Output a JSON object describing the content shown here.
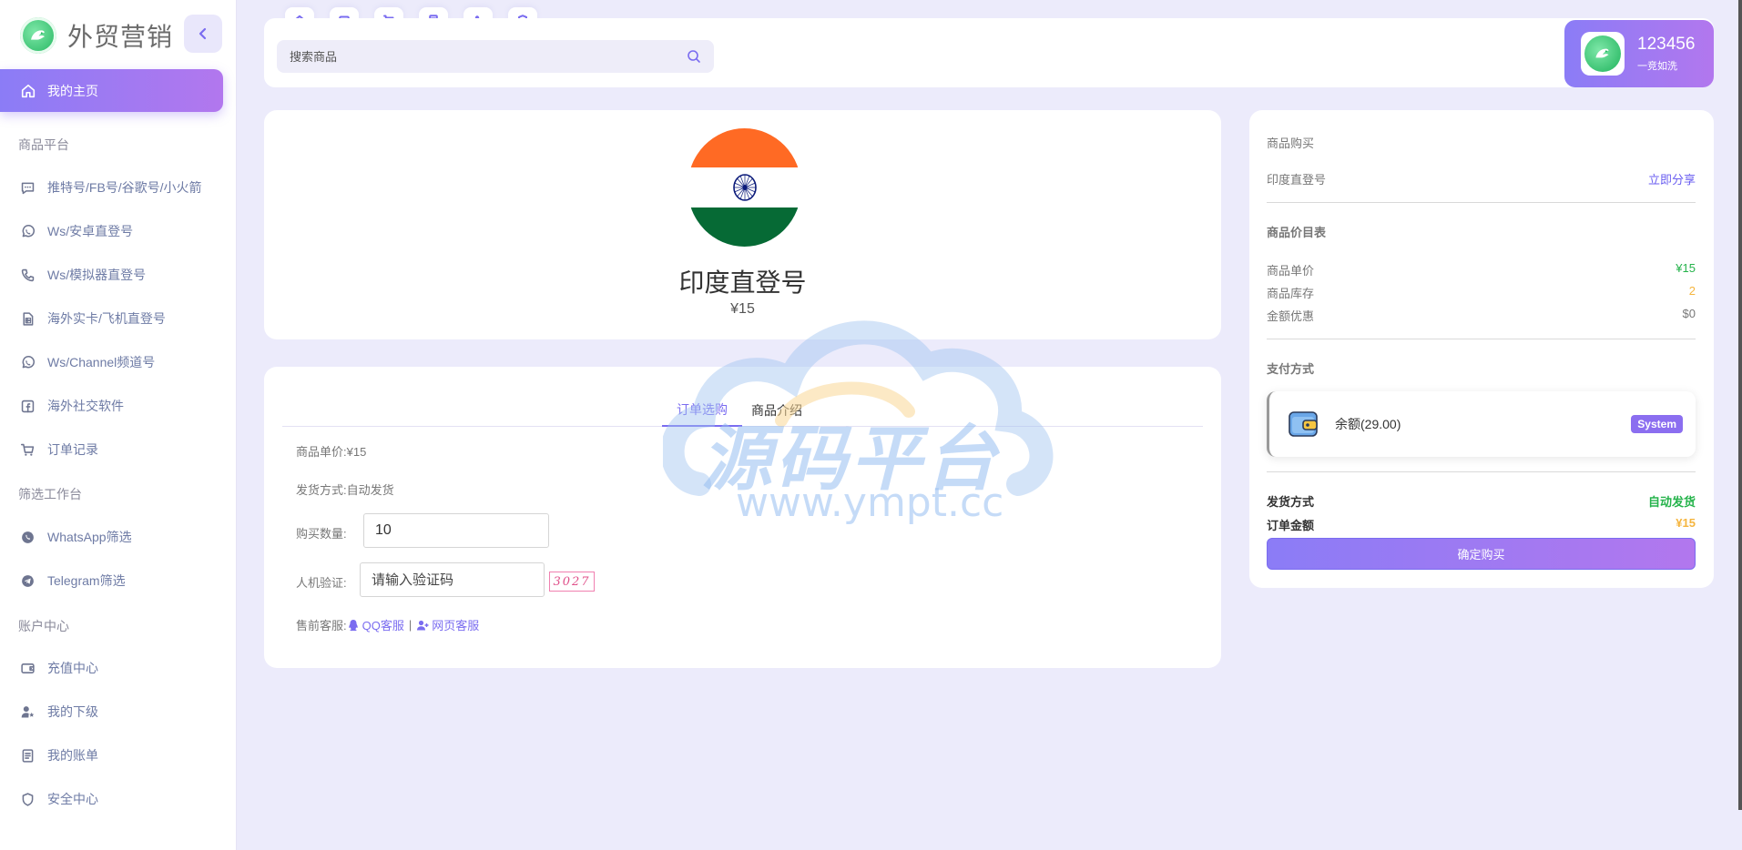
{
  "brand": {
    "name": "外贸营销"
  },
  "sidebar": {
    "active": {
      "label": "我的主页",
      "icon": "home-icon"
    },
    "sections": [
      {
        "title": "商品平台",
        "items": [
          {
            "label": "推特号/FB号/谷歌号/小火箭",
            "icon": "message-icon"
          },
          {
            "label": "Ws/安卓直登号",
            "icon": "whatsapp-icon"
          },
          {
            "label": "Ws/模拟器直登号",
            "icon": "phone-icon"
          },
          {
            "label": "海外实卡/飞机直登号",
            "icon": "sim-card-icon"
          },
          {
            "label": "Ws/Channel频道号",
            "icon": "whatsapp-icon"
          },
          {
            "label": "海外社交软件",
            "icon": "facebook-icon"
          },
          {
            "label": "订单记录",
            "icon": "cart-icon"
          }
        ]
      },
      {
        "title": "筛选工作台",
        "items": [
          {
            "label": "WhatsApp筛选",
            "icon": "whatsapp-icon"
          },
          {
            "label": "Telegram筛选",
            "icon": "telegram-icon"
          }
        ]
      },
      {
        "title": "账户中心",
        "items": [
          {
            "label": "充值中心",
            "icon": "wallet-icon"
          },
          {
            "label": "我的下级",
            "icon": "user-star-icon"
          },
          {
            "label": "我的账单",
            "icon": "bill-icon"
          },
          {
            "label": "安全中心",
            "icon": "shield-icon"
          }
        ]
      }
    ]
  },
  "topbar": {
    "quick_tabs": [
      "home-icon",
      "wallet-icon",
      "cart-icon",
      "bill-icon",
      "user-star-icon",
      "shield-icon"
    ],
    "search": {
      "placeholder": "搜索商品",
      "value": ""
    },
    "user": {
      "name": "123456",
      "motto": "一竞如洗"
    }
  },
  "product": {
    "title": "印度直登号",
    "price": "¥15",
    "flag": {
      "top": "#ff6a24",
      "middle": "#ffffff",
      "bottom": "#066a35",
      "chakra": "#0b1a7a"
    }
  },
  "order": {
    "tabs": [
      {
        "label": "订单选购",
        "active": true
      },
      {
        "label": "商品介绍",
        "active": false
      }
    ],
    "unit_price_label": "商品单价:",
    "unit_price_value": "¥15",
    "delivery_label": "发货方式:",
    "delivery_value": "自动发货",
    "quantity_label": "购买数量:",
    "quantity_value": "10",
    "captcha_label": "人机验证:",
    "captcha_placeholder": "请输入验证码",
    "captcha_code": "3027",
    "support_label": "售前客服:",
    "support_qq": "QQ客服",
    "support_sep": "|",
    "support_web": "网页客服"
  },
  "purchase": {
    "heading": "商品购买",
    "product_name": "印度直登号",
    "share": "立即分享",
    "price_table_heading": "商品价目表",
    "unit_price_label": "商品单价",
    "unit_price_value": "¥15",
    "stock_label": "商品库存",
    "stock_value": "2",
    "discount_label": "金额优惠",
    "discount_value": "$0",
    "payment_heading": "支付方式",
    "payment_option": {
      "label": "余额(29.00)",
      "badge": "System"
    },
    "delivery_label": "发货方式",
    "delivery_value": "自动发货",
    "total_label": "订单金额",
    "total_value": "¥15",
    "confirm": "确定购买"
  },
  "watermark": {
    "main": "源码平台",
    "url": "www.ympt.cc"
  },
  "colors": {
    "accent": "#7a6cf0",
    "gradient_start": "#8b7cf6",
    "gradient_end": "#b277ee",
    "green": "#25b34b",
    "orange": "#f5b53f"
  }
}
